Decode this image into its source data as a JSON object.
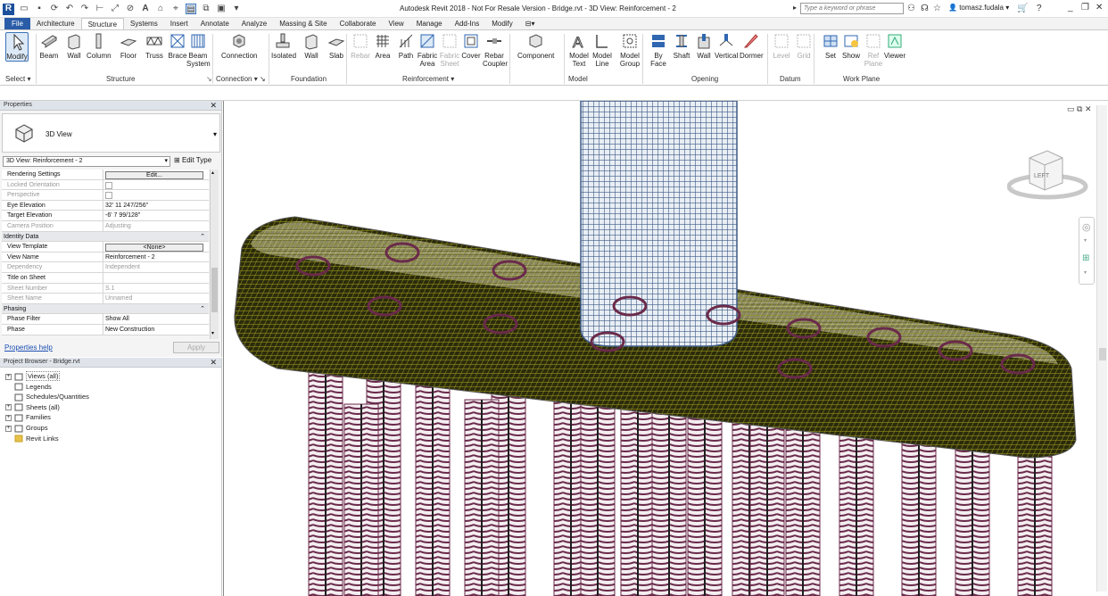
{
  "window": {
    "title": "Autodesk Revit 2018 - Not For Resale Version -    Bridge.rvt - 3D View: Reinforcement - 2",
    "search_placeholder": "Type a keyword or phrase",
    "user": "tomasz.fudala"
  },
  "tabs": [
    "File",
    "Architecture",
    "Structure",
    "Systems",
    "Insert",
    "Annotate",
    "Analyze",
    "Massing & Site",
    "Collaborate",
    "View",
    "Manage",
    "Add-Ins",
    "Modify"
  ],
  "active_tab": "Structure",
  "ribbon": {
    "buttons": [
      {
        "id": "modify",
        "l1": "Modify",
        "l2": "",
        "icon": "cursor-icon",
        "enabled": true
      },
      {
        "id": "beam",
        "l1": "Beam",
        "l2": "",
        "icon": "beam-icon",
        "enabled": true
      },
      {
        "id": "wall",
        "l1": "Wall",
        "l2": "",
        "icon": "wall-icon",
        "enabled": true
      },
      {
        "id": "column",
        "l1": "Column",
        "l2": "",
        "icon": "column-icon",
        "enabled": true
      },
      {
        "id": "floor",
        "l1": "Floor",
        "l2": "",
        "icon": "floor-icon",
        "enabled": true
      },
      {
        "id": "truss",
        "l1": "Truss",
        "l2": "",
        "icon": "truss-icon",
        "enabled": true
      },
      {
        "id": "brace",
        "l1": "Brace",
        "l2": "",
        "icon": "brace-icon",
        "enabled": true
      },
      {
        "id": "beamsystem",
        "l1": "Beam",
        "l2": "System",
        "icon": "beam-system-icon",
        "enabled": true
      },
      {
        "id": "connection",
        "l1": "Connection",
        "l2": "",
        "icon": "connection-icon",
        "enabled": true
      },
      {
        "id": "isolated",
        "l1": "Isolated",
        "l2": "",
        "icon": "isolated-foundation-icon",
        "enabled": true
      },
      {
        "id": "fwall",
        "l1": "Wall",
        "l2": "",
        "icon": "wall-foundation-icon",
        "enabled": true
      },
      {
        "id": "slab",
        "l1": "Slab",
        "l2": "",
        "icon": "slab-icon",
        "enabled": true
      },
      {
        "id": "rebar",
        "l1": "Rebar",
        "l2": "",
        "icon": "rebar-icon",
        "enabled": false
      },
      {
        "id": "area",
        "l1": "Area",
        "l2": "",
        "icon": "area-icon",
        "enabled": true
      },
      {
        "id": "path",
        "l1": "Path",
        "l2": "",
        "icon": "path-icon",
        "enabled": true
      },
      {
        "id": "fabricarea",
        "l1": "Fabric",
        "l2": "Area",
        "icon": "fabric-area-icon",
        "enabled": true
      },
      {
        "id": "fabricsheet",
        "l1": "Fabric",
        "l2": "Sheet",
        "icon": "fabric-sheet-icon",
        "enabled": false
      },
      {
        "id": "cover",
        "l1": "Cover",
        "l2": "",
        "icon": "cover-icon",
        "enabled": true
      },
      {
        "id": "rebarcoupler",
        "l1": "Rebar",
        "l2": "Coupler",
        "icon": "rebar-coupler-icon",
        "enabled": true
      },
      {
        "id": "component",
        "l1": "Component",
        "l2": "",
        "icon": "component-icon",
        "enabled": true
      },
      {
        "id": "modeltext",
        "l1": "Model",
        "l2": "Text",
        "icon": "model-text-icon",
        "enabled": true
      },
      {
        "id": "modelline",
        "l1": "Model",
        "l2": "Line",
        "icon": "model-line-icon",
        "enabled": true
      },
      {
        "id": "modelgroup",
        "l1": "Model",
        "l2": "Group",
        "icon": "model-group-icon",
        "enabled": true
      },
      {
        "id": "byface",
        "l1": "By",
        "l2": "Face",
        "icon": "by-face-icon",
        "enabled": true
      },
      {
        "id": "shaft",
        "l1": "Shaft",
        "l2": "",
        "icon": "shaft-icon",
        "enabled": true
      },
      {
        "id": "owall",
        "l1": "Wall",
        "l2": "",
        "icon": "wall-opening-icon",
        "enabled": true
      },
      {
        "id": "vertical",
        "l1": "Vertical",
        "l2": "",
        "icon": "vertical-opening-icon",
        "enabled": true
      },
      {
        "id": "dormer",
        "l1": "Dormer",
        "l2": "",
        "icon": "dormer-icon",
        "enabled": true
      },
      {
        "id": "level",
        "l1": "Level",
        "l2": "",
        "icon": "level-icon",
        "enabled": false
      },
      {
        "id": "grid",
        "l1": "Grid",
        "l2": "",
        "icon": "grid-icon",
        "enabled": false
      },
      {
        "id": "set",
        "l1": "Set",
        "l2": "",
        "icon": "set-workplane-icon",
        "enabled": true
      },
      {
        "id": "show",
        "l1": "Show",
        "l2": "",
        "icon": "show-workplane-icon",
        "enabled": true
      },
      {
        "id": "refplane",
        "l1": "Ref",
        "l2": "Plane",
        "icon": "ref-plane-icon",
        "enabled": false
      },
      {
        "id": "viewer",
        "l1": "Viewer",
        "l2": "",
        "icon": "viewer-icon",
        "enabled": true
      }
    ],
    "groups": [
      "Select",
      "Structure",
      "Connection",
      "Foundation",
      "Reinforcement",
      "Model",
      "Opening",
      "Datum",
      "Work Plane"
    ]
  },
  "properties": {
    "title": "Properties",
    "type_name": "3D View",
    "view_selector": "3D View: Reinforcement - 2",
    "edit_type": "Edit Type",
    "rows": [
      {
        "k": "Rendering Settings",
        "v": "Edit...",
        "kind": "button",
        "dim": false
      },
      {
        "k": "Locked Orientation",
        "v": "",
        "kind": "check",
        "dim": true
      },
      {
        "k": "Perspective",
        "v": "",
        "kind": "check",
        "dim": true
      },
      {
        "k": "Eye Elevation",
        "v": "32'  11 247/256\"",
        "kind": "text",
        "dim": false
      },
      {
        "k": "Target Elevation",
        "v": "-6'  7 99/128\"",
        "kind": "text",
        "dim": false
      },
      {
        "k": "Camera Position",
        "v": "Adjusting",
        "kind": "text",
        "dim": true
      },
      {
        "k": "Identity Data",
        "v": "",
        "kind": "section",
        "dim": false
      },
      {
        "k": "View Template",
        "v": "<None>",
        "kind": "button",
        "dim": false
      },
      {
        "k": "View Name",
        "v": "Reinforcement - 2",
        "kind": "text",
        "dim": false
      },
      {
        "k": "Dependency",
        "v": "Independent",
        "kind": "text",
        "dim": true
      },
      {
        "k": "Title on Sheet",
        "v": "",
        "kind": "text",
        "dim": false
      },
      {
        "k": "Sheet Number",
        "v": "S.1",
        "kind": "text",
        "dim": true
      },
      {
        "k": "Sheet Name",
        "v": "Unnamed",
        "kind": "text",
        "dim": true
      },
      {
        "k": "Phasing",
        "v": "",
        "kind": "section",
        "dim": false
      },
      {
        "k": "Phase Filter",
        "v": "Show All",
        "kind": "text",
        "dim": false
      },
      {
        "k": "Phase",
        "v": "New Construction",
        "kind": "text",
        "dim": false
      }
    ],
    "help_link": "Properties help",
    "apply_label": "Apply"
  },
  "project_browser": {
    "title": "Project Browser - Bridge.rvt",
    "items": [
      {
        "label": "Views (all)",
        "icon": "views-icon",
        "expandable": true
      },
      {
        "label": "Legends",
        "icon": "legends-icon",
        "expandable": false
      },
      {
        "label": "Schedules/Quantities",
        "icon": "schedules-icon",
        "expandable": false
      },
      {
        "label": "Sheets (all)",
        "icon": "sheets-icon",
        "expandable": true
      },
      {
        "label": "Families",
        "icon": "families-icon",
        "expandable": true
      },
      {
        "label": "Groups",
        "icon": "groups-icon",
        "expandable": true
      },
      {
        "label": "Revit Links",
        "icon": "revit-links-icon",
        "expandable": false
      }
    ]
  },
  "viewcube": {
    "face": "LEFT"
  },
  "colors": {
    "slab_rebar": "#8e8c1c",
    "slab_rebar_dark": "#2b2b0c",
    "pile_rebar": "#6a2a4a",
    "column_rebar": "#3c5a86",
    "file_tab": "#2a5ca8"
  }
}
